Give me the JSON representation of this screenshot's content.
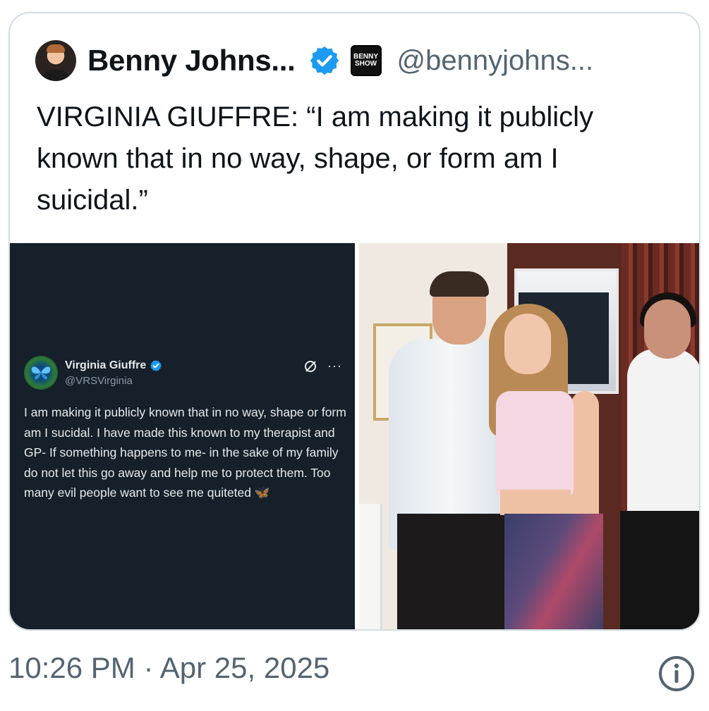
{
  "tweet": {
    "display_name": "Benny Johns...",
    "handle": "@bennyjohns...",
    "badge_logo_lines": [
      "BENNY",
      "SHOW"
    ],
    "text": "VIRGINIA GIUFFRE: “I am making it publicly known that in no way, shape, or form am I suicidal.”",
    "timestamp": "10:26 PM · Apr 25, 2025",
    "icons": {
      "avatar": "profile-avatar",
      "verified": "verified-badge-icon",
      "info": "info-icon"
    },
    "colors": {
      "verified": "#1d9bf0",
      "text": "#0f1419",
      "secondary": "#536471",
      "media_dark": "#15202b"
    }
  },
  "embedded_post": {
    "name": "Virginia Giuffre",
    "handle": "@VRSVirginia",
    "text": "I am making it publicly known that in no way, shape or form am I sucidal. I have made this known to my therapist and GP- If something happens to me- in the sake of my family do not let this go away and help me to protect them. Too many evil people want to see me quiteted",
    "emoji": "🦋",
    "icons": {
      "avatar": "butterfly-avatar",
      "grok": "slashed-circle-icon",
      "more": "more-dots-icon"
    }
  },
  "photo": {
    "description_icon": "group-photo-image"
  }
}
